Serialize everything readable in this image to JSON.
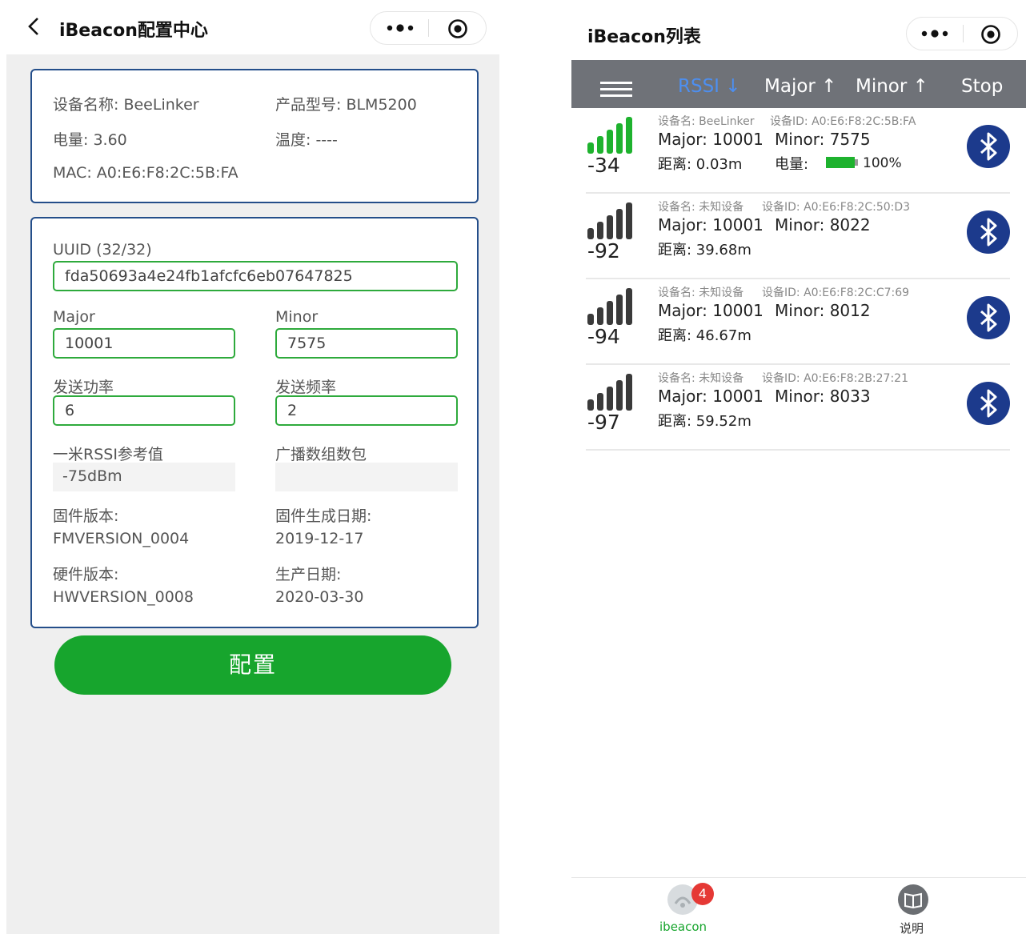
{
  "left": {
    "title": "iBeacon配置中心",
    "info": {
      "device_name": "设备名称: BeeLinker",
      "product_model": "产品型号: BLM5200",
      "battery": "电量: 3.60",
      "temperature": "温度: ----",
      "mac": "MAC: A0:E6:F8:2C:5B:FA"
    },
    "form": {
      "uuid_label": "UUID (32/32)",
      "uuid_value": "fda50693a4e24fb1afcfc6eb07647825",
      "major_label": "Major",
      "major_value": "10001",
      "minor_label": "Minor",
      "minor_value": "7575",
      "tx_power_label": "发送功率",
      "tx_power_value": "6",
      "tx_freq_label": "发送频率",
      "tx_freq_value": "2",
      "rssi_ref_label": "一米RSSI参考值",
      "rssi_ref_value": "-75dBm",
      "adv_packet_label": "广播数组数包",
      "adv_packet_value": ""
    },
    "versions": {
      "fw_label": "固件版本:",
      "fw_value": "FMVERSION_0004",
      "fw_date_label": "固件生成日期:",
      "fw_date_value": "2019-12-17",
      "hw_label": "硬件版本:",
      "hw_value": "HWVERSION_0008",
      "mfg_date_label": "生产日期:",
      "mfg_date_value": "2020-03-30"
    },
    "config_button": "配置"
  },
  "right": {
    "title": "iBeacon列表",
    "sort": {
      "rssi": "RSSI ↓",
      "major": "Major ↑",
      "minor": "Minor ↑",
      "stop": "Stop"
    },
    "devices": [
      {
        "rssi": "-34",
        "name": "设备名: BeeLinker",
        "id": "设备ID: A0:E6:F8:2C:5B:FA",
        "major": "Major: 10001",
        "minor": "Minor: 7575",
        "distance": "距离: 0.03m",
        "battery_label": "电量:",
        "battery_value": "100%",
        "battery_level": 1.0,
        "signal_bars_active": 5
      },
      {
        "rssi": "-92",
        "name": "设备名: 未知设备",
        "id": "设备ID: A0:E6:F8:2C:50:D3",
        "major": "Major: 10001",
        "minor": "Minor: 8022",
        "distance": "距离: 39.68m",
        "signal_bars_active": 0
      },
      {
        "rssi": "-94",
        "name": "设备名: 未知设备",
        "id": "设备ID: A0:E6:F8:2C:C7:69",
        "major": "Major: 10001",
        "minor": "Minor: 8012",
        "distance": "距离: 46.67m",
        "signal_bars_active": 0
      },
      {
        "rssi": "-97",
        "name": "设备名: 未知设备",
        "id": "设备ID: A0:E6:F8:2B:27:21",
        "major": "Major: 10001",
        "minor": "Minor: 8033",
        "distance": "距离: 59.52m",
        "signal_bars_active": 0
      }
    ],
    "tabs": [
      {
        "label": "ibeacon",
        "badge": "4"
      },
      {
        "label": "说明"
      }
    ]
  },
  "colors": {
    "accent_green": "#17a52d",
    "panel_border": "#244e8a",
    "sort_active": "#4d8ff0",
    "bluetooth": "#1c3a8c",
    "badge": "#e53935"
  }
}
